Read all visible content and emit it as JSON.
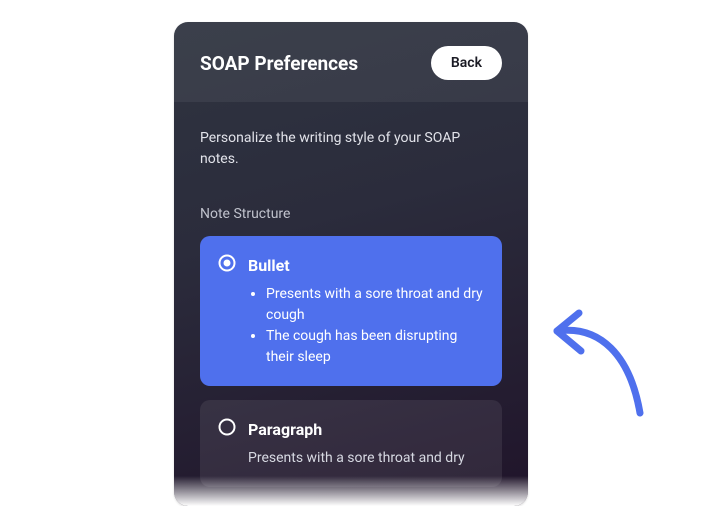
{
  "header": {
    "title": "SOAP Preferences",
    "back_label": "Back"
  },
  "description": "Personalize the writing style of your SOAP notes.",
  "section_label": "Note Structure",
  "options": [
    {
      "id": "bullet",
      "label": "Bullet",
      "selected": true,
      "bullets": [
        "Presents with a sore throat and dry cough",
        "The cough has been disrupting their sleep"
      ]
    },
    {
      "id": "paragraph",
      "label": "Paragraph",
      "selected": false,
      "paragraph": "Presents with a sore throat and dry"
    }
  ],
  "colors": {
    "accent": "#4f70ed",
    "arrow": "#4f70ed"
  }
}
